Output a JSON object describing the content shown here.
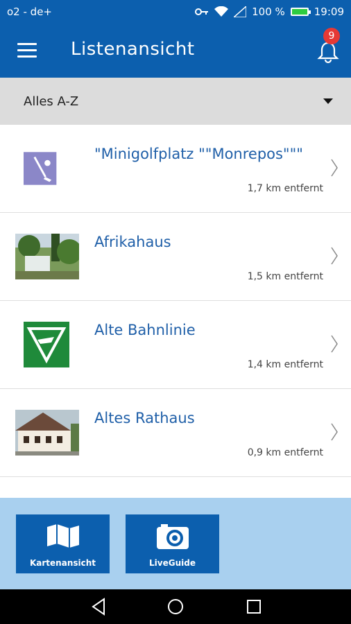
{
  "status_bar": {
    "carrier": "o2 - de+",
    "battery": "100 %",
    "time": "19:09",
    "icons": [
      "key-icon",
      "wifi-icon",
      "signal-icon",
      "battery-icon"
    ]
  },
  "app_bar": {
    "title": "Listenansicht",
    "notification_count": "9",
    "icons": [
      "menu-icon",
      "bell-icon"
    ]
  },
  "filter": {
    "selected": "Alles A-Z"
  },
  "list": {
    "items": [
      {
        "title": "\"Minigolfplatz \"\"Monrepos\"\"\"",
        "distance": "1,7 km entfernt",
        "thumb": "golf-icon"
      },
      {
        "title": "Afrikahaus",
        "distance": "1,5 km entfernt",
        "thumb": "photo-house"
      },
      {
        "title": "Alte Bahnlinie",
        "distance": "1,4 km entfernt",
        "thumb": "hiking-sign-icon"
      },
      {
        "title": "Altes Rathaus",
        "distance": "0,9 km entfernt",
        "thumb": "photo-townhall"
      }
    ]
  },
  "bottom_buttons": {
    "map_label": "Kartenansicht",
    "guide_label": "LiveGuide"
  },
  "colors": {
    "primary": "#0c5fae",
    "link": "#1f5fa8",
    "bottom_bg": "#a9d0ef",
    "badge": "#e53935"
  }
}
